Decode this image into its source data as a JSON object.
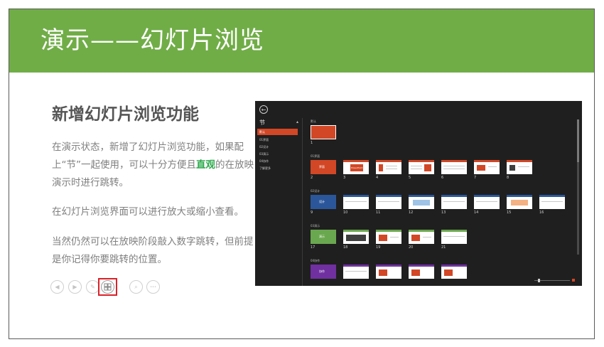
{
  "title": "演示——幻灯片浏览",
  "heading": "新增幻灯片浏览功能",
  "paragraphs": {
    "p1_a": "在演示状态，新增了幻灯片浏览功能，如果配上“节”一起使用，可以十分方便且",
    "p1_highlight": "直观",
    "p1_b": "的在放映演示时进行跳转。",
    "p2": "在幻灯片浏览界面可以进行放大或缩小查看。",
    "p3": "当然仍然可以在放映阶段敲入数字跳转，但前提是你记得你要跳转的位置。"
  },
  "controls": [
    {
      "name": "previous-icon",
      "glyph": "◀"
    },
    {
      "name": "next-icon",
      "glyph": "▶"
    },
    {
      "name": "pen-icon",
      "glyph": "✎"
    },
    {
      "name": "slide-sorter-icon",
      "glyph": ""
    },
    {
      "name": "zoom-icon",
      "glyph": "⌕"
    },
    {
      "name": "more-icon",
      "glyph": "•••"
    }
  ],
  "screenshot": {
    "back_glyph": "←",
    "nav_head": "节",
    "nav_caret": "▴",
    "nav_items": [
      "默认",
      "01界面",
      "02设计",
      "03演示",
      "04协作",
      "了解更多"
    ],
    "sections": [
      "默认",
      "01界面",
      "02设计",
      "03演示",
      "04协作"
    ],
    "slide_numbers": [
      "1",
      "2",
      "3",
      "4",
      "5",
      "6",
      "7",
      "8",
      "9",
      "10",
      "11",
      "12",
      "13",
      "14",
      "15",
      "16",
      "17",
      "18",
      "19",
      "20",
      "21"
    ],
    "section_titles": [
      "界面",
      "设计",
      "演示",
      "协作"
    ],
    "misc_thumb_text": "PowerPoint"
  },
  "colors": {
    "title_bar": "#70ad47",
    "highlight": "#2aa84a",
    "ppt_accent": "#d24726",
    "control_highlight": "#d9232a"
  }
}
